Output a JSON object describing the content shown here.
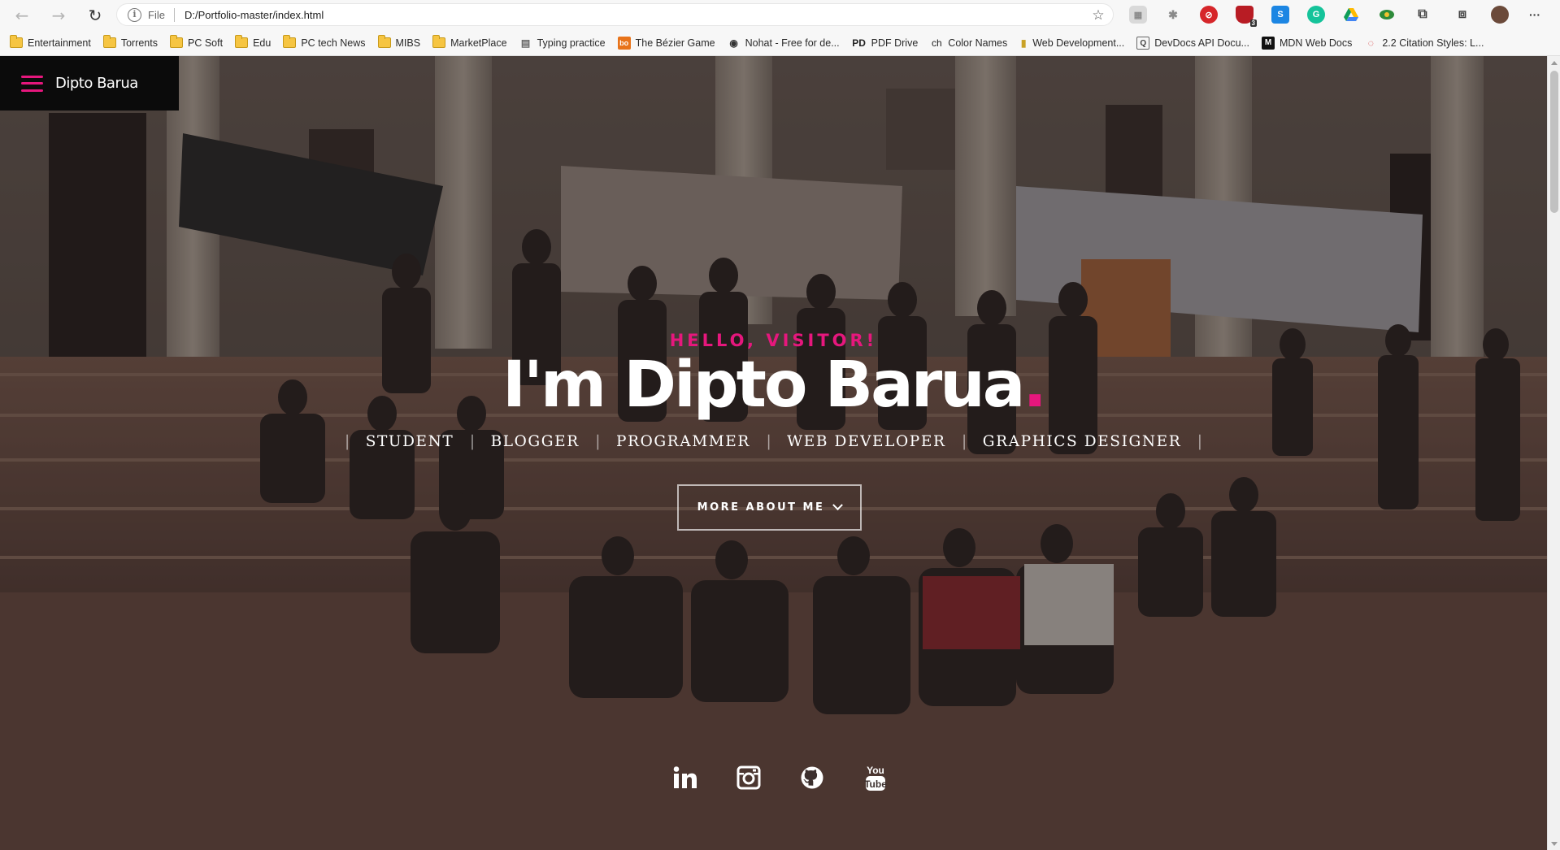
{
  "browser": {
    "url_scheme": "File",
    "url": "D:/Portfolio-master/index.html",
    "bookmarks": [
      {
        "label": "Entertainment",
        "icon": "folder-icon"
      },
      {
        "label": "Torrents",
        "icon": "folder-icon"
      },
      {
        "label": "PC Soft",
        "icon": "folder-icon"
      },
      {
        "label": "Edu",
        "icon": "folder-icon"
      },
      {
        "label": "PC tech News",
        "icon": "folder-icon"
      },
      {
        "label": "MIBS",
        "icon": "folder-icon"
      },
      {
        "label": "MarketPlace",
        "icon": "folder-icon"
      },
      {
        "label": "Typing practice",
        "icon": "typing-icon"
      },
      {
        "label": "The Bézier Game",
        "icon": "bezier-game-icon"
      },
      {
        "label": "Nohat - Free for de...",
        "icon": "eye-icon"
      },
      {
        "label": "PDF Drive",
        "icon": "pdf-drive-icon"
      },
      {
        "label": "Color Names",
        "icon": "color-names-icon"
      },
      {
        "label": "Web Development...",
        "icon": "web-dev-icon"
      },
      {
        "label": "DevDocs API Docu...",
        "icon": "devdocs-icon"
      },
      {
        "label": "MDN Web Docs",
        "icon": "mdn-icon"
      },
      {
        "label": "2.2 Citation Styles: L...",
        "icon": "citation-icon"
      }
    ],
    "bookmark_glyphs": {
      "typing": "▤",
      "bezier": "bo",
      "eye": "◉",
      "pdf": "PD",
      "color": "ch",
      "webdev": "▮",
      "devdocs": "Q",
      "mdn": "M",
      "citation": "◌"
    },
    "extension_badge": "3",
    "extension_labels": {
      "s": "S",
      "g": "G"
    },
    "nav_glyphs": {
      "back": "←",
      "forward": "→",
      "reload": "↻",
      "menu": "···",
      "favorite": "☆"
    }
  },
  "header": {
    "brand": "Dipto Barua"
  },
  "hero": {
    "greeting": "HELLO, VISITOR!",
    "headline": "I'm Dipto Barua",
    "headline_dot": ".",
    "roles": [
      "STUDENT",
      "BLOGGER",
      "PROGRAMMER",
      "WEB DEVELOPER",
      "GRAPHICS DESIGNER"
    ],
    "role_separator": "|",
    "cta_label": "MORE ABOUT ME"
  },
  "socials": [
    {
      "name": "linkedin",
      "icon": "linkedin-icon",
      "label": "in"
    },
    {
      "name": "instagram",
      "icon": "instagram-icon",
      "label": ""
    },
    {
      "name": "github",
      "icon": "github-icon",
      "label": ""
    },
    {
      "name": "youtube",
      "icon": "youtube-icon",
      "label": "You Tube"
    }
  ],
  "colors": {
    "accent": "#e6177d",
    "brand_bar": "#0b0b0b",
    "text": "#ffffff"
  }
}
